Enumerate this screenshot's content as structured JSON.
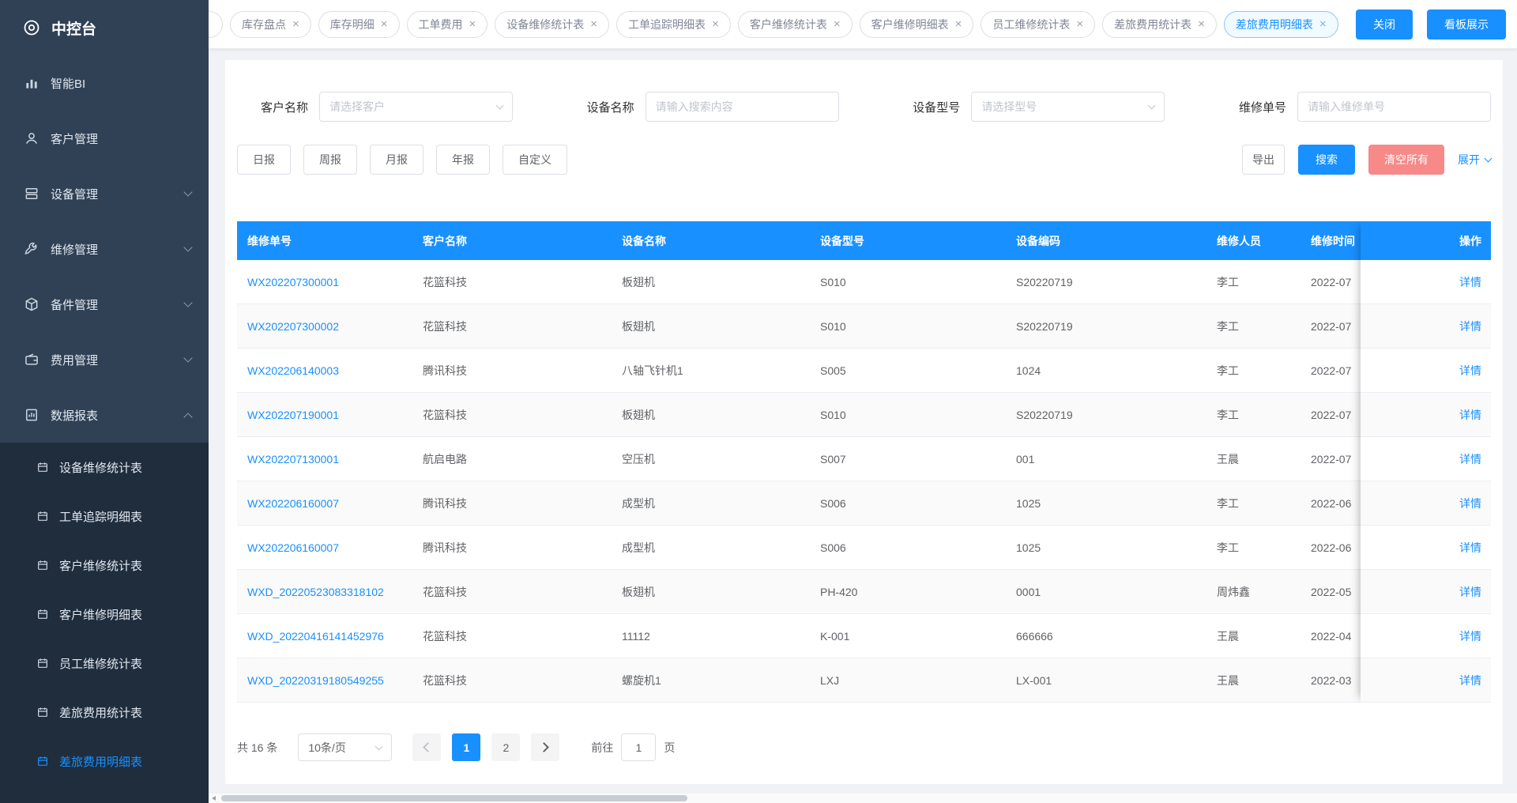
{
  "colors": {
    "accent": "#1890ff",
    "danger": "#f78989",
    "sidebar-bg": "#304156",
    "submenu-bg": "#1f2d3d",
    "table-header-bg": "#1890ff"
  },
  "sidebar": {
    "logo_label": "中控台",
    "items": [
      {
        "id": "smart-bi",
        "label": "智能BI",
        "icon": "chart-icon",
        "chevron": ""
      },
      {
        "id": "customer-management",
        "label": "客户管理",
        "icon": "users-icon",
        "chevron": ""
      },
      {
        "id": "device-management",
        "label": "设备管理",
        "icon": "device-icon",
        "chevron": "down"
      },
      {
        "id": "repair-management",
        "label": "维修管理",
        "icon": "wrench-icon",
        "chevron": "down"
      },
      {
        "id": "spareparts-management",
        "label": "备件管理",
        "icon": "box-icon",
        "chevron": "down"
      },
      {
        "id": "expense-management",
        "label": "费用管理",
        "icon": "wallet-icon",
        "chevron": "down"
      },
      {
        "id": "data-reports",
        "label": "数据报表",
        "icon": "report-icon",
        "chevron": "up"
      }
    ],
    "submenu": [
      {
        "id": "device-repair-stats",
        "label": "设备维修统计表",
        "active": false
      },
      {
        "id": "workorder-trace-detail",
        "label": "工单追踪明细表",
        "active": false
      },
      {
        "id": "customer-repair-stats",
        "label": "客户维修统计表",
        "active": false
      },
      {
        "id": "customer-repair-detail",
        "label": "客户维修明细表",
        "active": false
      },
      {
        "id": "employee-repair-stats",
        "label": "员工维修统计表",
        "active": false
      },
      {
        "id": "travel-expense-stats",
        "label": "差旅费用统计表",
        "active": false
      },
      {
        "id": "travel-expense-detail",
        "label": "差旅费用明细表",
        "active": true
      }
    ]
  },
  "tabs": {
    "items": [
      {
        "id": "inventory-check",
        "label": "库存盘点",
        "active": false
      },
      {
        "id": "inventory-detail",
        "label": "库存明细",
        "active": false
      },
      {
        "id": "workorder-expense",
        "label": "工单费用",
        "active": false
      },
      {
        "id": "device-repair-stats",
        "label": "设备维修统计表",
        "active": false
      },
      {
        "id": "workorder-trace-detail",
        "label": "工单追踪明细表",
        "active": false
      },
      {
        "id": "customer-repair-stats",
        "label": "客户维修统计表",
        "active": false
      },
      {
        "id": "customer-repair-detail",
        "label": "客户维修明细表",
        "active": false
      },
      {
        "id": "employee-repair-stats",
        "label": "员工维修统计表",
        "active": false
      },
      {
        "id": "travel-expense-stats",
        "label": "差旅费用统计表",
        "active": false
      },
      {
        "id": "travel-expense-detail",
        "label": "差旅费用明细表",
        "active": true
      }
    ],
    "close_button": "关闭",
    "board_button": "看板展示"
  },
  "filters": {
    "customer": {
      "label": "客户名称",
      "placeholder": "请选择客户"
    },
    "device_name": {
      "label": "设备名称",
      "placeholder": "请输入搜索内容"
    },
    "device_model": {
      "label": "设备型号",
      "placeholder": "请选择型号"
    },
    "repair_order": {
      "label": "维修单号",
      "placeholder": "请输入维修单号"
    },
    "period_buttons": [
      {
        "id": "daily",
        "label": "日报"
      },
      {
        "id": "weekly",
        "label": "周报"
      },
      {
        "id": "monthly",
        "label": "月报"
      },
      {
        "id": "yearly",
        "label": "年报"
      },
      {
        "id": "custom",
        "label": "自定义"
      }
    ],
    "export_label": "导出",
    "search_label": "搜索",
    "clear_label": "清空所有",
    "expand_label": "展开"
  },
  "table": {
    "headers": [
      "维修单号",
      "客户名称",
      "设备名称",
      "设备型号",
      "设备编码",
      "维修人员",
      "维修时间",
      "操作"
    ],
    "action_label": "详情",
    "rows": [
      {
        "order": "WX202207300001",
        "customer": "花篮科技",
        "device": "板翅机",
        "model": "S010",
        "code": "S20220719",
        "staff": "李工",
        "time": "2022-07"
      },
      {
        "order": "WX202207300002",
        "customer": "花篮科技",
        "device": "板翅机",
        "model": "S010",
        "code": "S20220719",
        "staff": "李工",
        "time": "2022-07"
      },
      {
        "order": "WX202206140003",
        "customer": "腾讯科技",
        "device": "八轴飞针机1",
        "model": "S005",
        "code": "1024",
        "staff": "李工",
        "time": "2022-07"
      },
      {
        "order": "WX202207190001",
        "customer": "花篮科技",
        "device": "板翅机",
        "model": "S010",
        "code": "S20220719",
        "staff": "李工",
        "time": "2022-07"
      },
      {
        "order": "WX202207130001",
        "customer": "航启电路",
        "device": "空压机",
        "model": "S007",
        "code": "001",
        "staff": "王晨",
        "time": "2022-07"
      },
      {
        "order": "WX202206160007",
        "customer": "腾讯科技",
        "device": "成型机",
        "model": "S006",
        "code": "1025",
        "staff": "李工",
        "time": "2022-06"
      },
      {
        "order": "WX202206160007",
        "customer": "腾讯科技",
        "device": "成型机",
        "model": "S006",
        "code": "1025",
        "staff": "李工",
        "time": "2022-06"
      },
      {
        "order": "WXD_20220523083318102",
        "customer": "花篮科技",
        "device": "板翅机",
        "model": "PH-420",
        "code": "0001",
        "staff": "周炜鑫",
        "time": "2022-05"
      },
      {
        "order": "WXD_20220416141452976",
        "customer": "花篮科技",
        "device": "11112",
        "model": "K-001",
        "code": "666666",
        "staff": "王晨",
        "time": "2022-04"
      },
      {
        "order": "WXD_20220319180549255",
        "customer": "花篮科技",
        "device": "螺旋机1",
        "model": "LXJ",
        "code": "LX-001",
        "staff": "王晨",
        "time": "2022-03"
      }
    ]
  },
  "pagination": {
    "total_label": "共 16 条",
    "page_size_label": "10条/页",
    "pages": [
      "1",
      "2"
    ],
    "active_page": "1",
    "goto_label": "前往",
    "goto_value": "1",
    "unit_label": "页"
  }
}
